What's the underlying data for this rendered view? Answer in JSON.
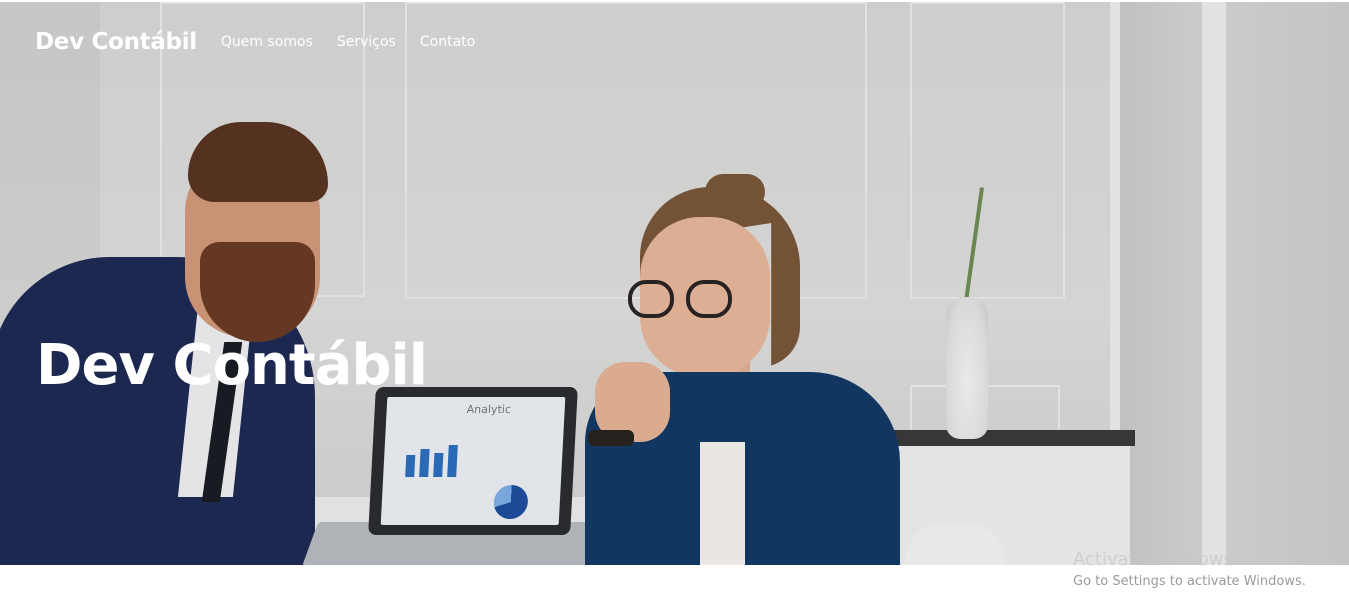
{
  "navbar": {
    "brand": "Dev Contábil",
    "links": [
      {
        "label": "Quem somos"
      },
      {
        "label": "Serviços"
      },
      {
        "label": "Contato"
      }
    ]
  },
  "hero": {
    "title": "Dev Contábil",
    "image_icon": "office-photo",
    "laptop_screen_title": "Analytic"
  },
  "watermark": {
    "title": "Activate Windows",
    "subtitle": "Go to Settings to activate Windows."
  }
}
